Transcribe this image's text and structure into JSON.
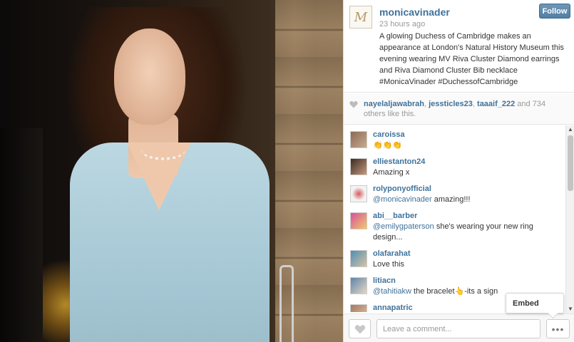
{
  "post": {
    "username": "monicavinader",
    "time": "23 hours ago",
    "caption": "A glowing Duchess of Cambridge makes an appearance at London's Natural History Museum this evening wearing MV Riva Cluster Diamond earrings and Riva Diamond Cluster Bib necklace #MonicaVinader #DuchessofCambridge",
    "follow_label": "Follow",
    "logo_letter": "M"
  },
  "likes": {
    "user1": "nayelaljawabrah",
    "sep1": ", ",
    "user2": "jessticles23",
    "sep2": ", ",
    "user3": "taaaif_222",
    "and": " and ",
    "count": "734",
    "suffix": " others like this."
  },
  "comments": [
    {
      "user": "caroissa",
      "text": "👏👏👏"
    },
    {
      "user": "elliestanton24",
      "text": "Amazing x"
    },
    {
      "user": "rolyponyofficial",
      "mention": "@monicavinader",
      "text": " amazing!!!"
    },
    {
      "user": "abi__barber",
      "mention": "@emilygpaterson",
      "text": " she's wearing your new ring design..."
    },
    {
      "user": "olafarahat",
      "text": "Love this"
    },
    {
      "user": "litiacn",
      "mention": "@tahitiakw",
      "text": " the bracelet👆-its a sign"
    },
    {
      "user": "annapatric",
      "text": ""
    }
  ],
  "footer": {
    "comment_placeholder": "Leave a comment...",
    "more_label": "•••",
    "embed_label": "Embed"
  },
  "colors": {
    "link": "#3f729b",
    "follow_bg": "#517fa4"
  }
}
